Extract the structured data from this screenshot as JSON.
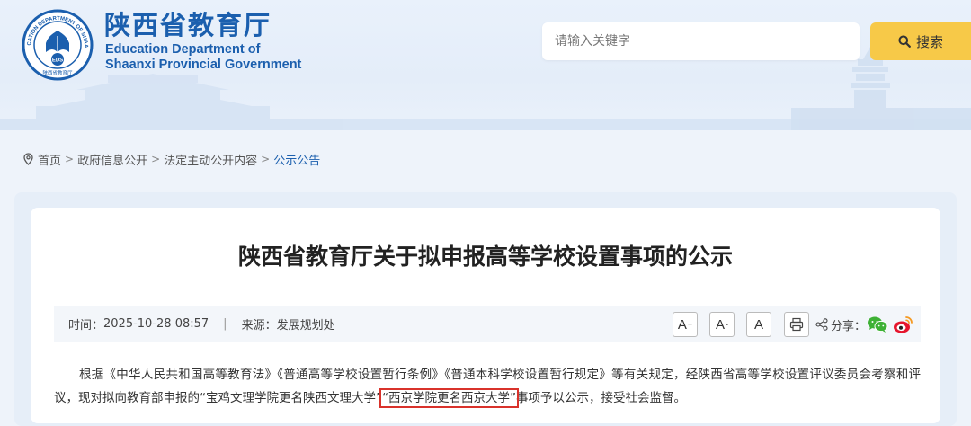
{
  "header": {
    "title_cn": "陕西省教育厅",
    "title_en_line1": "Education Department of",
    "title_en_line2": "Shaanxi Provincial Government",
    "logo": {
      "ring_text": "EDUCATION DEPARTMENT OF SHAANXI",
      "bottom_text": "陕西省教育厅",
      "abbr": "EDS",
      "color": "#1b5fae"
    },
    "search": {
      "placeholder": "请输入关键字",
      "button_label": "搜索",
      "button_color": "#f7c948"
    }
  },
  "breadcrumb": {
    "items": [
      "首页",
      "政府信息公开",
      "法定主动公开内容",
      "公示公告"
    ],
    "separator": ">"
  },
  "article": {
    "title": "陕西省教育厅关于拟申报高等学校设置事项的公示",
    "meta": {
      "time_label": "时间：",
      "time_value": "2025-10-28 08:57",
      "divider": "|",
      "source_label": "来源：",
      "source_value": "发展规划处"
    },
    "tools": {
      "font_increase": "A",
      "font_increase_sup": "+",
      "font_decrease": "A",
      "font_decrease_sup": "-",
      "font_reset": "A",
      "share_label": "分享："
    },
    "body_before": "根据《中华人民共和国高等教育法》《普通高等学校设置暂行条例》《普通本科学校设置暂行规定》等有关规定，经陕西省高等学校设置评议委员会考察和评议，现对拟向教育部申报的“宝鸡文理学院更名陕西文理大学”",
    "body_highlight": "“西京学院更名西京大学”",
    "body_after": "事项予以公示，接受社会监督。",
    "highlight_color": "#d9322b"
  },
  "colors": {
    "brand": "#1b5fae",
    "accent": "#f7c948",
    "wechat": "#3eb135",
    "weibo": "#e6162d"
  }
}
